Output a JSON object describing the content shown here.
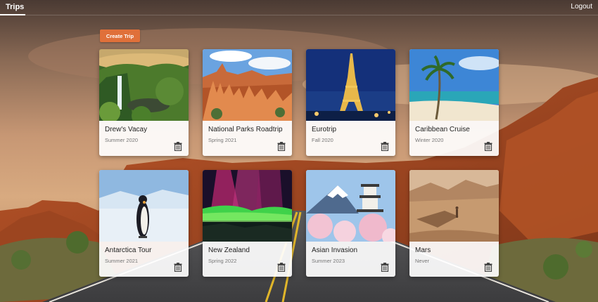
{
  "nav": {
    "brand": "Trips",
    "logout": "Logout"
  },
  "actions": {
    "create_trip": "Create Trip"
  },
  "trips": [
    {
      "title": "Drew's Vacay",
      "season": "Summer 2020",
      "image": "waterfall"
    },
    {
      "title": "National Parks Roadtrip",
      "season": "Spring 2021",
      "image": "canyon"
    },
    {
      "title": "Eurotrip",
      "season": "Fall 2020",
      "image": "eiffel"
    },
    {
      "title": "Caribbean Cruise",
      "season": "Winter 2020",
      "image": "beach"
    },
    {
      "title": "Antarctica Tour",
      "season": "Summer 2021",
      "image": "penguin"
    },
    {
      "title": "New Zealand",
      "season": "Spring 2022",
      "image": "aurora"
    },
    {
      "title": "Asian Invasion",
      "season": "Summer 2023",
      "image": "fuji"
    },
    {
      "title": "Mars",
      "season": "Never",
      "image": "desert"
    }
  ],
  "colors": {
    "accent": "#e0703a"
  }
}
